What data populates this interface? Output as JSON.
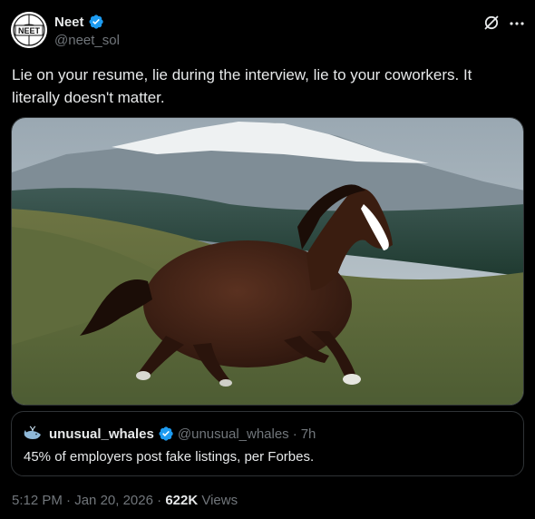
{
  "author": {
    "display_name": "Neet",
    "handle": "@neet_sol",
    "verified": true,
    "avatar_icon": "neet-logo-avatar",
    "avatar_text": "NEET"
  },
  "post": {
    "text": "Lie on your resume, lie during the interview, lie to your coworkers. It literally doesn't matter.",
    "media_description_icon": "running-horse-photo"
  },
  "quote": {
    "display_name": "unusual_whales",
    "handle": "@unusual_whales",
    "separator": "·",
    "time": "7h",
    "verified": true,
    "avatar_icon": "whale-icon",
    "text": "45% of employers post fake listings, per Forbes."
  },
  "meta": {
    "time": "5:12 PM",
    "separator": "·",
    "date": "Jan 20, 2026",
    "views_count": "622K",
    "views_label": "Views"
  },
  "icons": {
    "grok": "grok-icon",
    "more": "more-icon",
    "verified": "verified-badge-icon"
  },
  "colors": {
    "background": "#000000",
    "text_primary": "#e7e9ea",
    "text_secondary": "#71767b",
    "verified_blue": "#1d9bf0",
    "border": "#2f3336"
  }
}
